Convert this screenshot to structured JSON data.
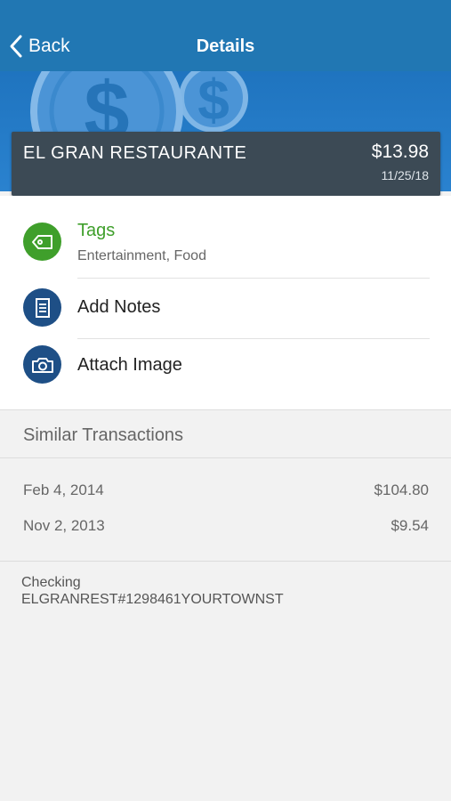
{
  "nav": {
    "back_label": "Back",
    "title": "Details"
  },
  "transaction": {
    "merchant": "EL GRAN RESTAURANTE",
    "amount": "$13.98",
    "date": "11/25/18"
  },
  "actions": {
    "tags": {
      "label": "Tags",
      "value": "Entertainment, Food",
      "icon": "tag-icon"
    },
    "notes": {
      "label": "Add Notes",
      "icon": "notes-icon"
    },
    "image": {
      "label": "Attach Image",
      "icon": "camera-icon"
    }
  },
  "similar": {
    "title": "Similar Transactions",
    "items": [
      {
        "date": "Feb 4, 2014",
        "amount": "$104.80"
      },
      {
        "date": "Nov 2, 2013",
        "amount": "$9.54"
      }
    ]
  },
  "account": {
    "type": "Checking",
    "description": "ELGRANREST#1298461YOURTOWNST"
  },
  "colors": {
    "nav": "#2177b3",
    "hero": "#2a82cf",
    "summary_bg": "#3c4a55",
    "tags_green": "#3f9f2b",
    "icon_navy": "#1e4f86"
  }
}
